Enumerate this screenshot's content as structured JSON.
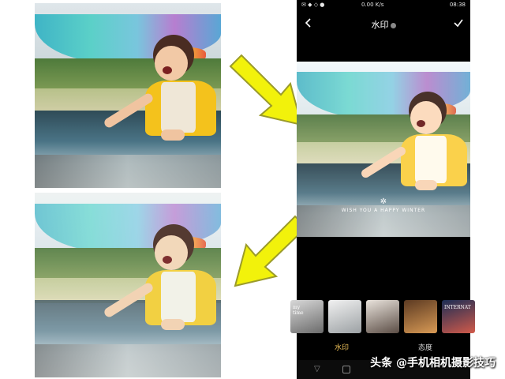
{
  "status": {
    "left_icons": "✉ ◆ ◇ ●",
    "speed": "0.00 K/s",
    "time": "08:38"
  },
  "topbar": {
    "title": "水印",
    "back_icon": "back-arrow-icon",
    "confirm_icon": "check-icon"
  },
  "watermark": {
    "mark": "✲",
    "text": "WISH YOU A HAPPY WINTER"
  },
  "thumbnails": [
    {
      "label": "my\ntime",
      "colors": [
        "#d8d8d8",
        "#6b6b6b"
      ]
    },
    {
      "label": "",
      "colors": [
        "#f1f1f1",
        "#9ca1a4"
      ]
    },
    {
      "label": "",
      "colors": [
        "#e9e3dc",
        "#5b4d45"
      ]
    },
    {
      "label": "",
      "colors": [
        "#5c3a22",
        "#d89a55"
      ]
    },
    {
      "label": "INTERNAT",
      "colors": [
        "#1b2d55",
        "#d25a4a"
      ]
    }
  ],
  "tabs": [
    {
      "label": "水印",
      "active": true
    },
    {
      "label": "态度",
      "active": false
    }
  ],
  "credit": {
    "text": "头条 @手机相机摄影技巧"
  },
  "colors": {
    "arrow_fill": "#f2f20b",
    "arrow_stroke": "#9b9b2a",
    "active_tab": "#f0c35a"
  }
}
